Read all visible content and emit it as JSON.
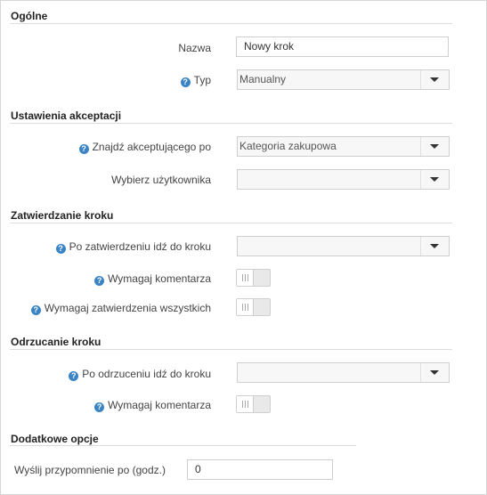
{
  "sections": {
    "general": "Ogólne",
    "acceptance": "Ustawienia akceptacji",
    "approval": "Zatwierdzanie kroku",
    "rejection": "Odrzucanie kroku",
    "extra": "Dodatkowe opcje"
  },
  "general": {
    "name_label": "Nazwa",
    "name_value": "Nowy krok",
    "type_label": "Typ",
    "type_value": "Manualny"
  },
  "acceptance": {
    "find_label": "Znajdź akceptującego po",
    "find_value": "Kategoria zakupowa",
    "user_label": "Wybierz użytkownika",
    "user_value": ""
  },
  "approval": {
    "next_label": "Po zatwierdzeniu idź do kroku",
    "next_value": "",
    "comment_label": "Wymagaj komentarza",
    "comment_on": false,
    "all_label": "Wymagaj zatwierdzenia wszystkich",
    "all_on": false
  },
  "rejection": {
    "next_label": "Po odrzuceniu idź do kroku",
    "next_value": "",
    "comment_label": "Wymagaj komentarza",
    "comment_on": false
  },
  "extra": {
    "reminder_label": "Wyślij przypomnienie po (godz.)",
    "reminder_value": "0"
  },
  "icons": {
    "help": "question-circle-icon",
    "dropdown": "chevron-down-icon",
    "toggle_grip": "grip-icon"
  },
  "colors": {
    "help_icon": "#3a84c5",
    "section_line": "#dcdcdc",
    "toggle_off": "#e9e9e9"
  }
}
